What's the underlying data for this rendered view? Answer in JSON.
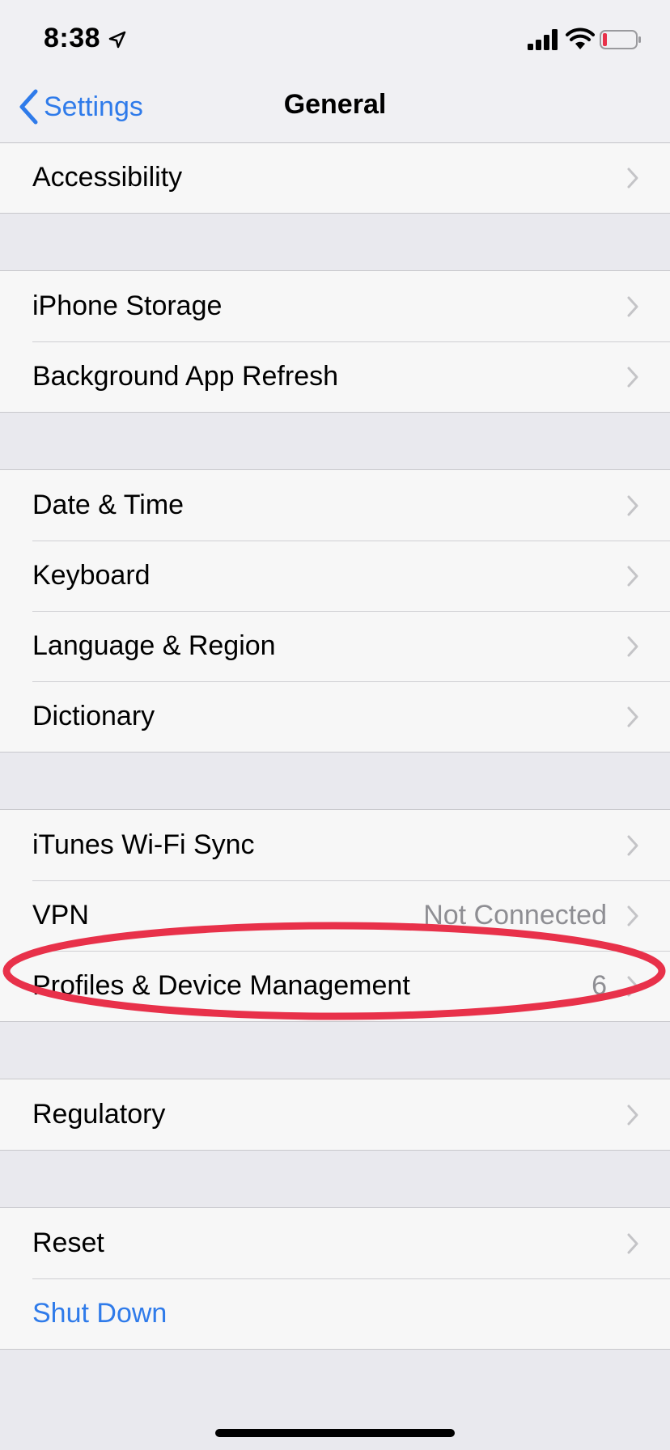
{
  "status_bar": {
    "time": "8:38"
  },
  "nav": {
    "back_label": "Settings",
    "title": "General"
  },
  "groups": [
    {
      "rows": [
        {
          "label": "Accessibility"
        }
      ]
    },
    {
      "rows": [
        {
          "label": "iPhone Storage"
        },
        {
          "label": "Background App Refresh"
        }
      ]
    },
    {
      "rows": [
        {
          "label": "Date & Time"
        },
        {
          "label": "Keyboard"
        },
        {
          "label": "Language & Region"
        },
        {
          "label": "Dictionary"
        }
      ]
    },
    {
      "rows": [
        {
          "label": "iTunes Wi-Fi Sync"
        },
        {
          "label": "VPN",
          "value": "Not Connected"
        },
        {
          "label": "Profiles & Device Management",
          "value": "6"
        }
      ]
    },
    {
      "rows": [
        {
          "label": "Regulatory"
        }
      ]
    },
    {
      "rows": [
        {
          "label": "Reset"
        },
        {
          "label": "Shut Down"
        }
      ]
    }
  ],
  "colors": {
    "accent": "#2f7bea",
    "annotation": "#e8314a",
    "secondary_text": "#8e8e93",
    "battery_low": "#e8314a"
  }
}
